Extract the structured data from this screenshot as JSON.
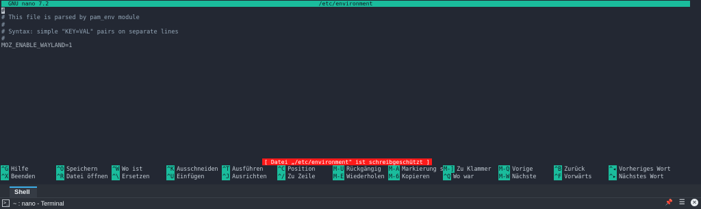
{
  "nano": {
    "version_label": "GNU nano 7.2",
    "filename": "/etc/environment"
  },
  "editor": {
    "cursor_char": "#",
    "lines": [
      "# This file is parsed by pam_env module",
      "#",
      "# Syntax: simple \"KEY=VAL\" pairs on separate lines",
      "#",
      "MOZ_ENABLE_WAYLAND=1"
    ]
  },
  "status_message": "[ Datei „/etc/environment\" ist schreibgeschützt ]",
  "shortcuts": {
    "row1": [
      {
        "key": "^G",
        "label": "Hilfe"
      },
      {
        "key": "^O",
        "label": "Speichern"
      },
      {
        "key": "^W",
        "label": "Wo ist"
      },
      {
        "key": "^K",
        "label": "Ausschneiden"
      },
      {
        "key": "^T",
        "label": "Ausführen"
      },
      {
        "key": "^C",
        "label": "Position"
      },
      {
        "key": "M-U",
        "label": "Rückgängig"
      },
      {
        "key": "M-A",
        "label": "Markierung se"
      },
      {
        "key": "M-]",
        "label": "Zu Klammer"
      },
      {
        "key": "M-Q",
        "label": "Vorige"
      },
      {
        "key": "^B",
        "label": "Zurück"
      },
      {
        "key": "^◂",
        "label": "Vorheriges Wort"
      }
    ],
    "row2": [
      {
        "key": "^X",
        "label": "Beenden"
      },
      {
        "key": "^R",
        "label": "Datei öffnen"
      },
      {
        "key": "^\\",
        "label": "Ersetzen"
      },
      {
        "key": "^U",
        "label": "Einfügen"
      },
      {
        "key": "^J",
        "label": "Ausrichten"
      },
      {
        "key": "^/",
        "label": "Zu Zeile"
      },
      {
        "key": "M-E",
        "label": "Wiederholen"
      },
      {
        "key": "M-6",
        "label": "Kopieren"
      },
      {
        "key": "^Q",
        "label": "Wo war"
      },
      {
        "key": "M-W",
        "label": "Nächste"
      },
      {
        "key": "^F",
        "label": "Vorwärts"
      },
      {
        "key": "^▸",
        "label": "Nächstes Wort"
      }
    ]
  },
  "panel": {
    "tab_label": "Shell",
    "task_title": "~ : nano - Terminal",
    "icons": [
      "terminal-icon",
      "pin-icon",
      "hamburger-menu-icon",
      "close-icon"
    ]
  },
  "colors": {
    "accent": "#1abc9c",
    "background": "#232833",
    "status_bg": "#ff1a1a",
    "panel_bg": "#2b3038"
  }
}
